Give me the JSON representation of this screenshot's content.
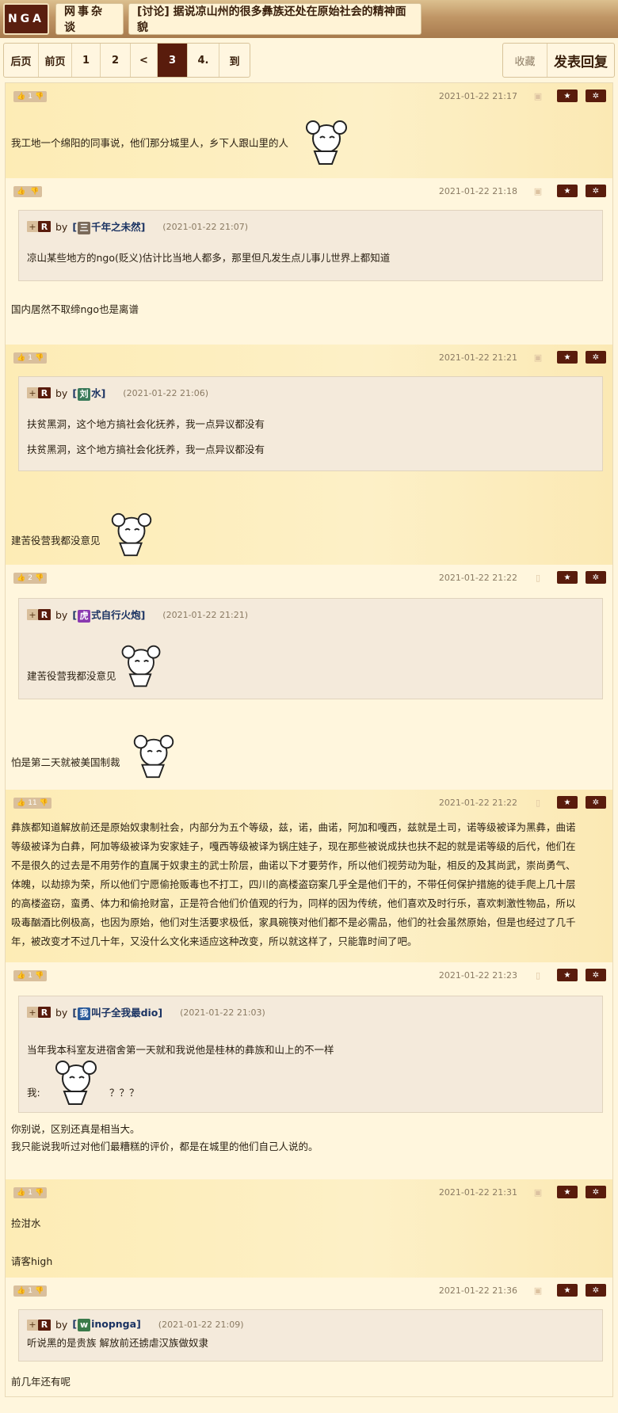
{
  "header": {
    "logo": "NGA",
    "forum": "网事杂谈",
    "thread_title": "[讨论] 据说凉山州的很多彝族还处在原始社会的精神面貌"
  },
  "pager": {
    "items": [
      "后页",
      "前页",
      "1",
      "2",
      "<",
      "3",
      "4.",
      "到"
    ],
    "current": "3"
  },
  "actions": {
    "favorite": "收藏",
    "reply": "发表回复"
  },
  "icons": {
    "like": "thumbs-up-icon",
    "dislike": "thumbs-down-icon",
    "star": "star-icon",
    "settings": "gear-icon",
    "device": "android-icon"
  },
  "colors": {
    "accent": "#591c0c",
    "bg": "#fff6dd",
    "alt_bg": "#fdeebd",
    "quote_bg": "#f4eadb",
    "username": "#1a3262"
  },
  "posts": [
    {
      "likes": "1",
      "date": "2021-01-22 21:17",
      "device": "android",
      "text": [
        "我工地一个绵阳的同事说，他们那分城里人，乡下人跟山里的人"
      ]
    },
    {
      "likes": "",
      "date": "2021-01-22 21:18",
      "device": "android",
      "quote": {
        "by": "by",
        "avatar": "三",
        "user": "千年之未然",
        "date": "(2021-01-22 21:07)",
        "text": [
          "凉山某些地方的ngo(贬义)估计比当地人都多，那里但凡发生点儿事儿世界上都知道"
        ]
      },
      "text": [
        "国内居然不取缔ngo也是离谱"
      ]
    },
    {
      "likes": "1",
      "date": "2021-01-22 21:21",
      "device": "android",
      "quote": {
        "by": "by",
        "avatar": "刘",
        "user": "水",
        "date": "(2021-01-22 21:06)",
        "text": [
          "扶贫黑洞，这个地方搞社会化抚养，我一点异议都没有",
          "扶贫黑洞，这个地方搞社会化抚养，我一点异议都没有"
        ]
      },
      "text": [
        "建苦役营我都没意见"
      ]
    },
    {
      "likes": "2",
      "date": "2021-01-22 21:22",
      "device": "phone",
      "quote": {
        "by": "by",
        "avatar": "虎",
        "user": "式自行火炮",
        "date": "(2021-01-22 21:21)",
        "text": [
          "建苦役营我都没意见"
        ]
      },
      "text": [
        "怕是第二天就被美国制裁"
      ]
    },
    {
      "likes": "11",
      "date": "2021-01-22 21:22",
      "device": "phone",
      "text": [
        "彝族都知道解放前还是原始奴隶制社会，内部分为五个等级，兹，诺，曲诺，阿加和嘎西，兹就是土司，诺等级被译为黑彝，曲诺",
        "等级被译为白彝，阿加等级被译为安家娃子，嘎西等级被译为锅庄娃子，现在那些被说成扶也扶不起的就是诺等级的后代，他们在",
        "不是很久的过去是不用劳作的直属于奴隶主的武士阶层，曲诺以下才要劳作，所以他们视劳动为耻，相反的及其尚武，崇尚勇气、",
        "体魄，以劫掠为荣，所以他们宁愿偷抢贩毒也不打工，四川的高楼盗窃案几乎全是他们干的，不带任何保护措施的徒手爬上几十层",
        "的高楼盗窃，蛮勇、体力和偷抢财富，正是符合他们价值观的行为，同样的因为传统，他们喜欢及时行乐，喜欢刺激性物品，所以",
        "吸毒酗酒比例极高，也因为原始，他们对生活要求极低，家具碗筷对他们都不是必需品，他们的社会虽然原始，但是也经过了几千",
        "年，被改变才不过几十年，又没什么文化来适应这种改变，所以就这样了，只能靠时间了吧。"
      ]
    },
    {
      "likes": "1",
      "date": "2021-01-22 21:23",
      "device": "phone",
      "quote": {
        "by": "by",
        "avatar": "我",
        "user": "叫子全我最dio",
        "date": "(2021-01-22 21:03)",
        "text": [
          "当年我本科室友进宿舍第一天就和我说他是桂林的彝族和山上的不一样",
          "我:",
          "？？？"
        ]
      },
      "text": [
        "你别说，区别还真是相当大。",
        "我只能说我听过对他们最糟糕的评价，都是在城里的他们自己人说的。"
      ]
    },
    {
      "likes": "1",
      "date": "2021-01-22 21:31",
      "device": "android",
      "text": [
        "捡泔水",
        "请客high"
      ]
    },
    {
      "likes": "1",
      "date": "2021-01-22 21:36",
      "device": "android",
      "quote": {
        "by": "by",
        "avatar": "w",
        "user": "inopnga",
        "date": "(2021-01-22 21:09)",
        "text": [
          "听说黑的是贵族 解放前还掳虐汉族做奴隶"
        ]
      },
      "text": [
        "前几年还有呢"
      ]
    }
  ]
}
